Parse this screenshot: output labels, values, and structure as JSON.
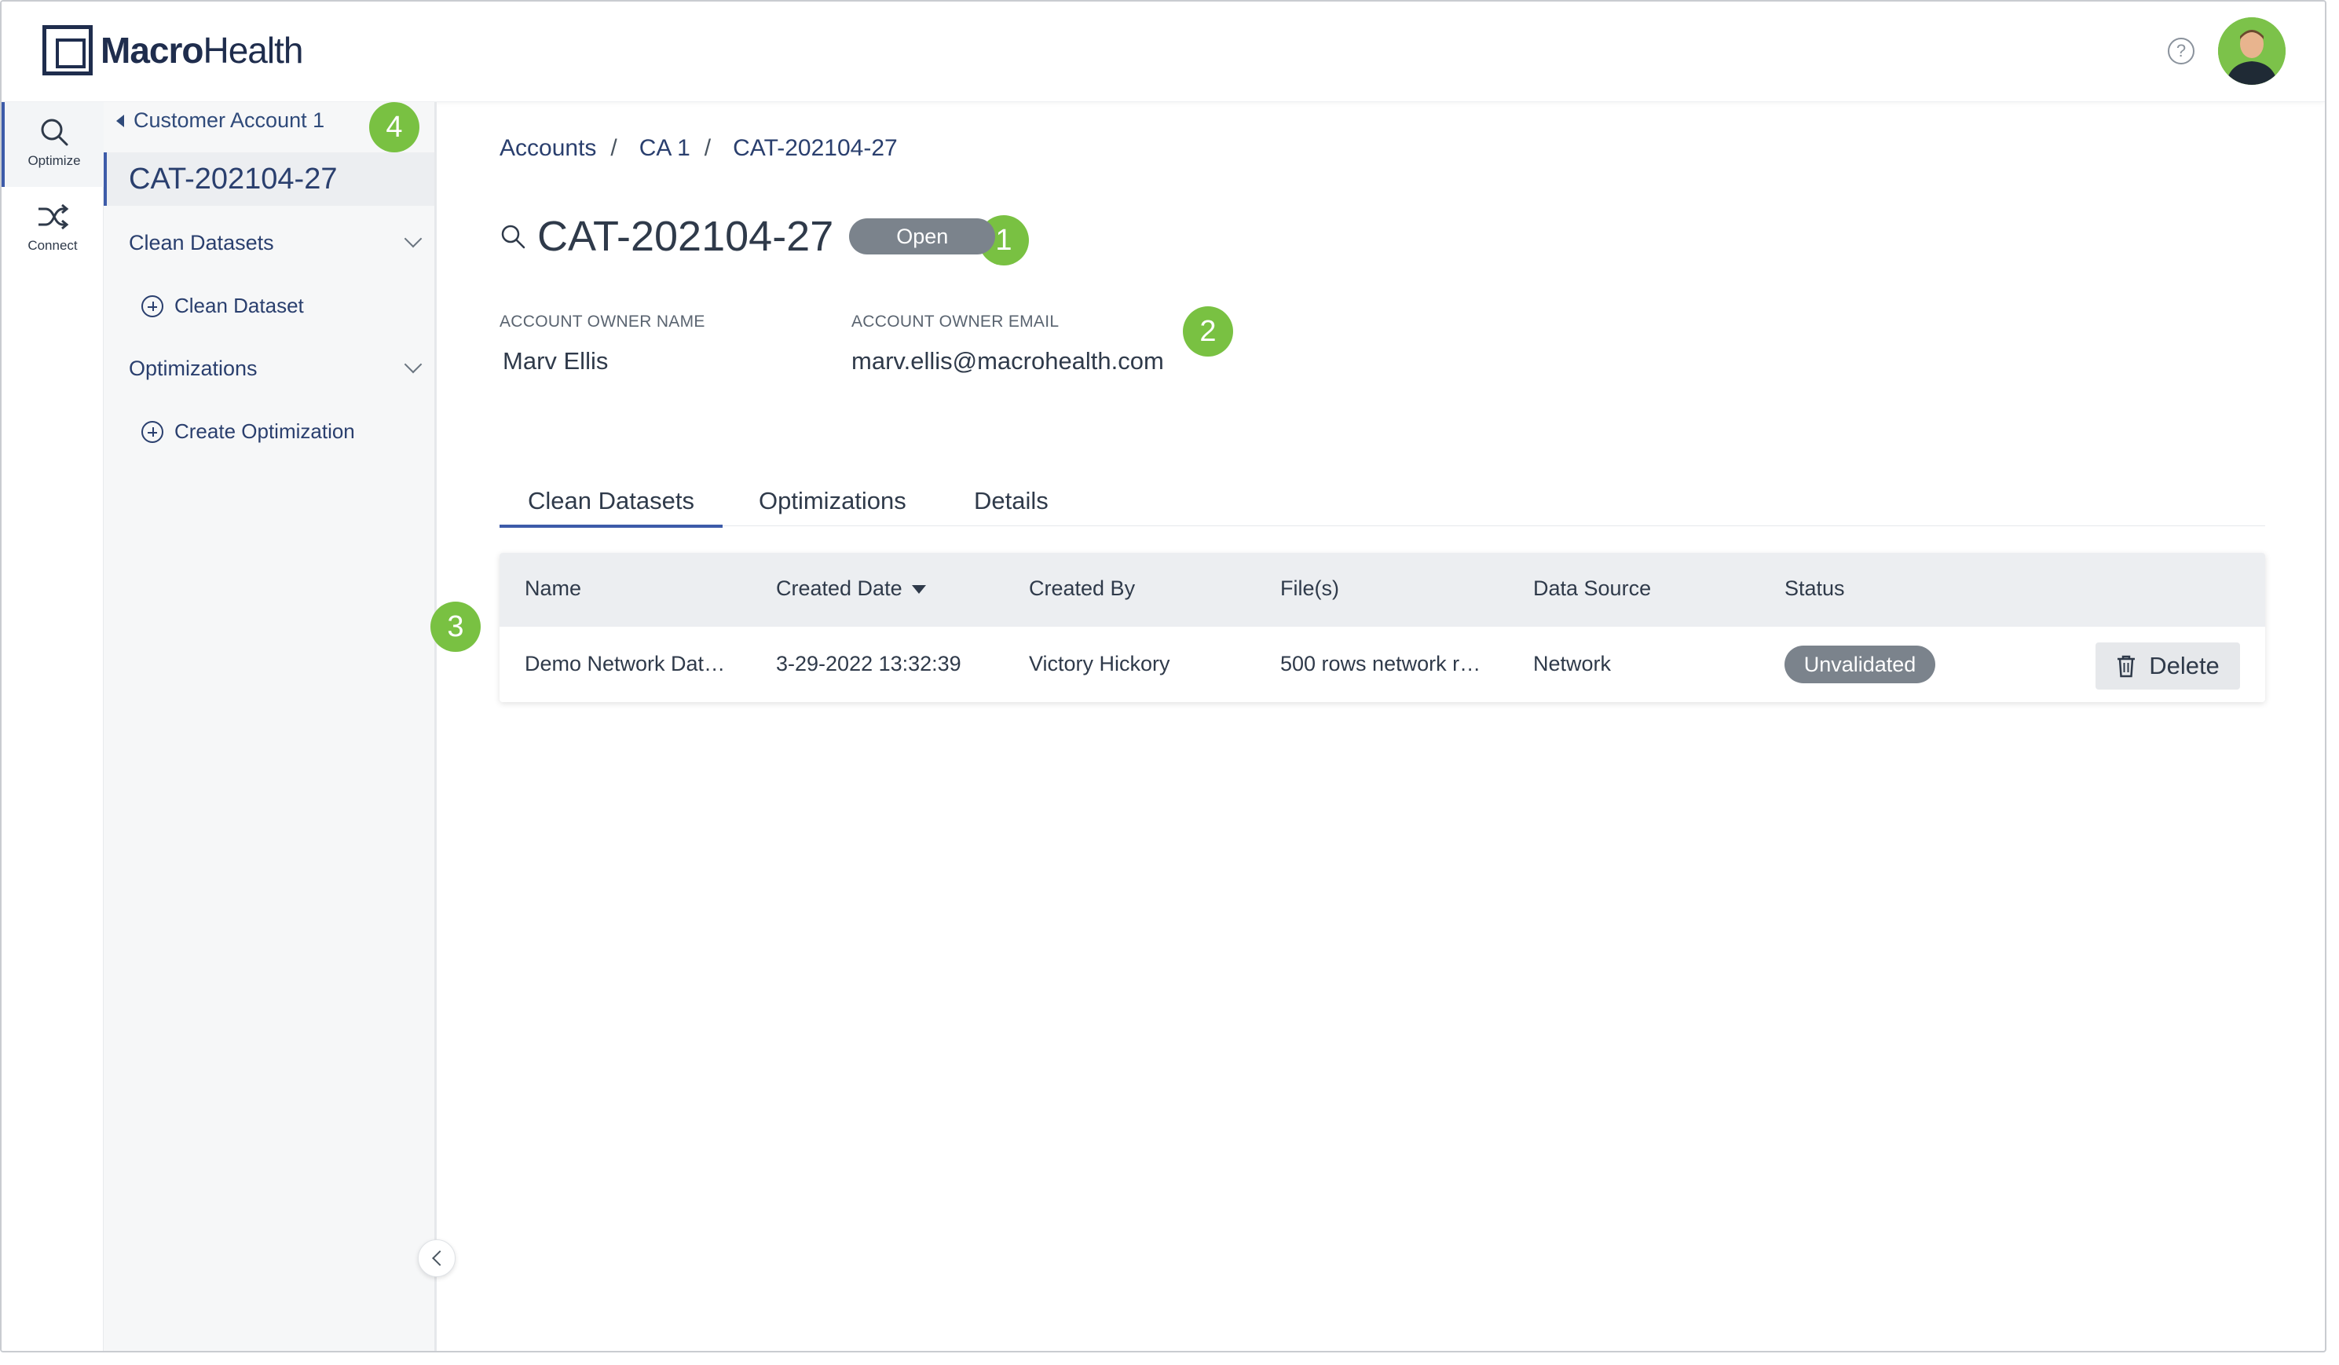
{
  "app": {
    "logo_bold": "Macro",
    "logo_regular": "Health",
    "help_symbol": "?",
    "accent_color": "#3d5ba9",
    "marker_color": "#79c142"
  },
  "rail": {
    "items": [
      {
        "label": "Optimize",
        "icon": "search-icon",
        "active": true
      },
      {
        "label": "Connect",
        "icon": "shuffle-icon",
        "active": false
      }
    ]
  },
  "sidenav": {
    "back_label": "Customer Account 1",
    "current": "CAT-202104-27",
    "sections": [
      {
        "label": "Clean Datasets",
        "action": "Clean Dataset"
      },
      {
        "label": "Optimizations",
        "action": "Create Optimization"
      }
    ]
  },
  "markers": [
    "1",
    "2",
    "3",
    "4"
  ],
  "breadcrumb": {
    "items": [
      "Accounts",
      "CA 1",
      "CAT-202104-27"
    ],
    "separator": "/"
  },
  "header": {
    "title": "CAT-202104-27",
    "status": "Open"
  },
  "account": {
    "owner_name_label": "ACCOUNT OWNER NAME",
    "owner_name": "Marv Ellis",
    "owner_email_label": "ACCOUNT OWNER EMAIL",
    "owner_email": "marv.ellis@macrohealth.com"
  },
  "tabs": [
    "Clean Datasets",
    "Optimizations",
    "Details"
  ],
  "table": {
    "columns": [
      "Name",
      "Created Date",
      "Created By",
      "File(s)",
      "Data Source",
      "Status"
    ],
    "rows": [
      {
        "name": "Demo Network Dat…",
        "created_date": "3-29-2022 13:32:39",
        "created_by": "Victory Hickory",
        "files": "500 rows network r…",
        "data_source": "Network",
        "status": "Unvalidated",
        "action": "Delete"
      }
    ]
  }
}
